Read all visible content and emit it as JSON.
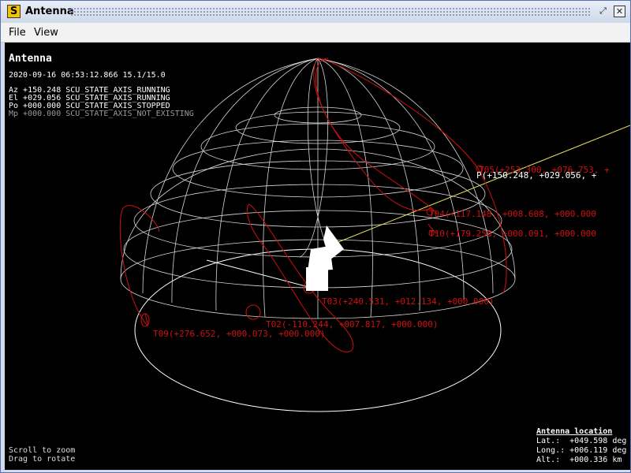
{
  "window": {
    "title": "Antenna",
    "app_icon_letter": "S"
  },
  "menubar": {
    "file": "File",
    "view": "View"
  },
  "viewport": {
    "title": "Antenna",
    "timestamp": "2020-09-16 06:53:12.866 15.1/15.0",
    "axes": [
      {
        "text": "Az +150.248 SCU_STATE_AXIS_RUNNING",
        "color": "#ffffff"
      },
      {
        "text": "El +029.056 SCU_STATE_AXIS_RUNNING",
        "color": "#ffffff"
      },
      {
        "text": "Po +000.000 SCU_STATE_AXIS_STOPPED",
        "color": "#ffffff"
      },
      {
        "text": "Mp +000.000 SCU_STATE_AXIS_NOT_EXISTING",
        "color": "#9a9a9a"
      }
    ],
    "pointing_label": "P(+150.248, +029.056, +",
    "track_labels": {
      "t05": "T05(+253.300, +076.753, +",
      "t04": "T04(+117.148, +008.608, +000.000",
      "t10": "T10(+179.258, +000.091, +000.000",
      "t03": "T03(+240.531, +012.134, +000.000)",
      "t02": "T02(-110.244, +007.817, +000.000)",
      "t09": "T09(+276.652, +000.073, +000.000)"
    },
    "hints": [
      "Scroll to zoom",
      "Drag to rotate"
    ],
    "location": {
      "title": "Antenna location",
      "lat": "Lat.:  +049.598 deg",
      "long": "Long.: +006.119 deg",
      "alt": "Alt.:  +000.336 km"
    },
    "colors": {
      "grid": "#d8d8d8",
      "track": "#d01010",
      "pointer": "#e8e060",
      "background": "#000000"
    }
  }
}
